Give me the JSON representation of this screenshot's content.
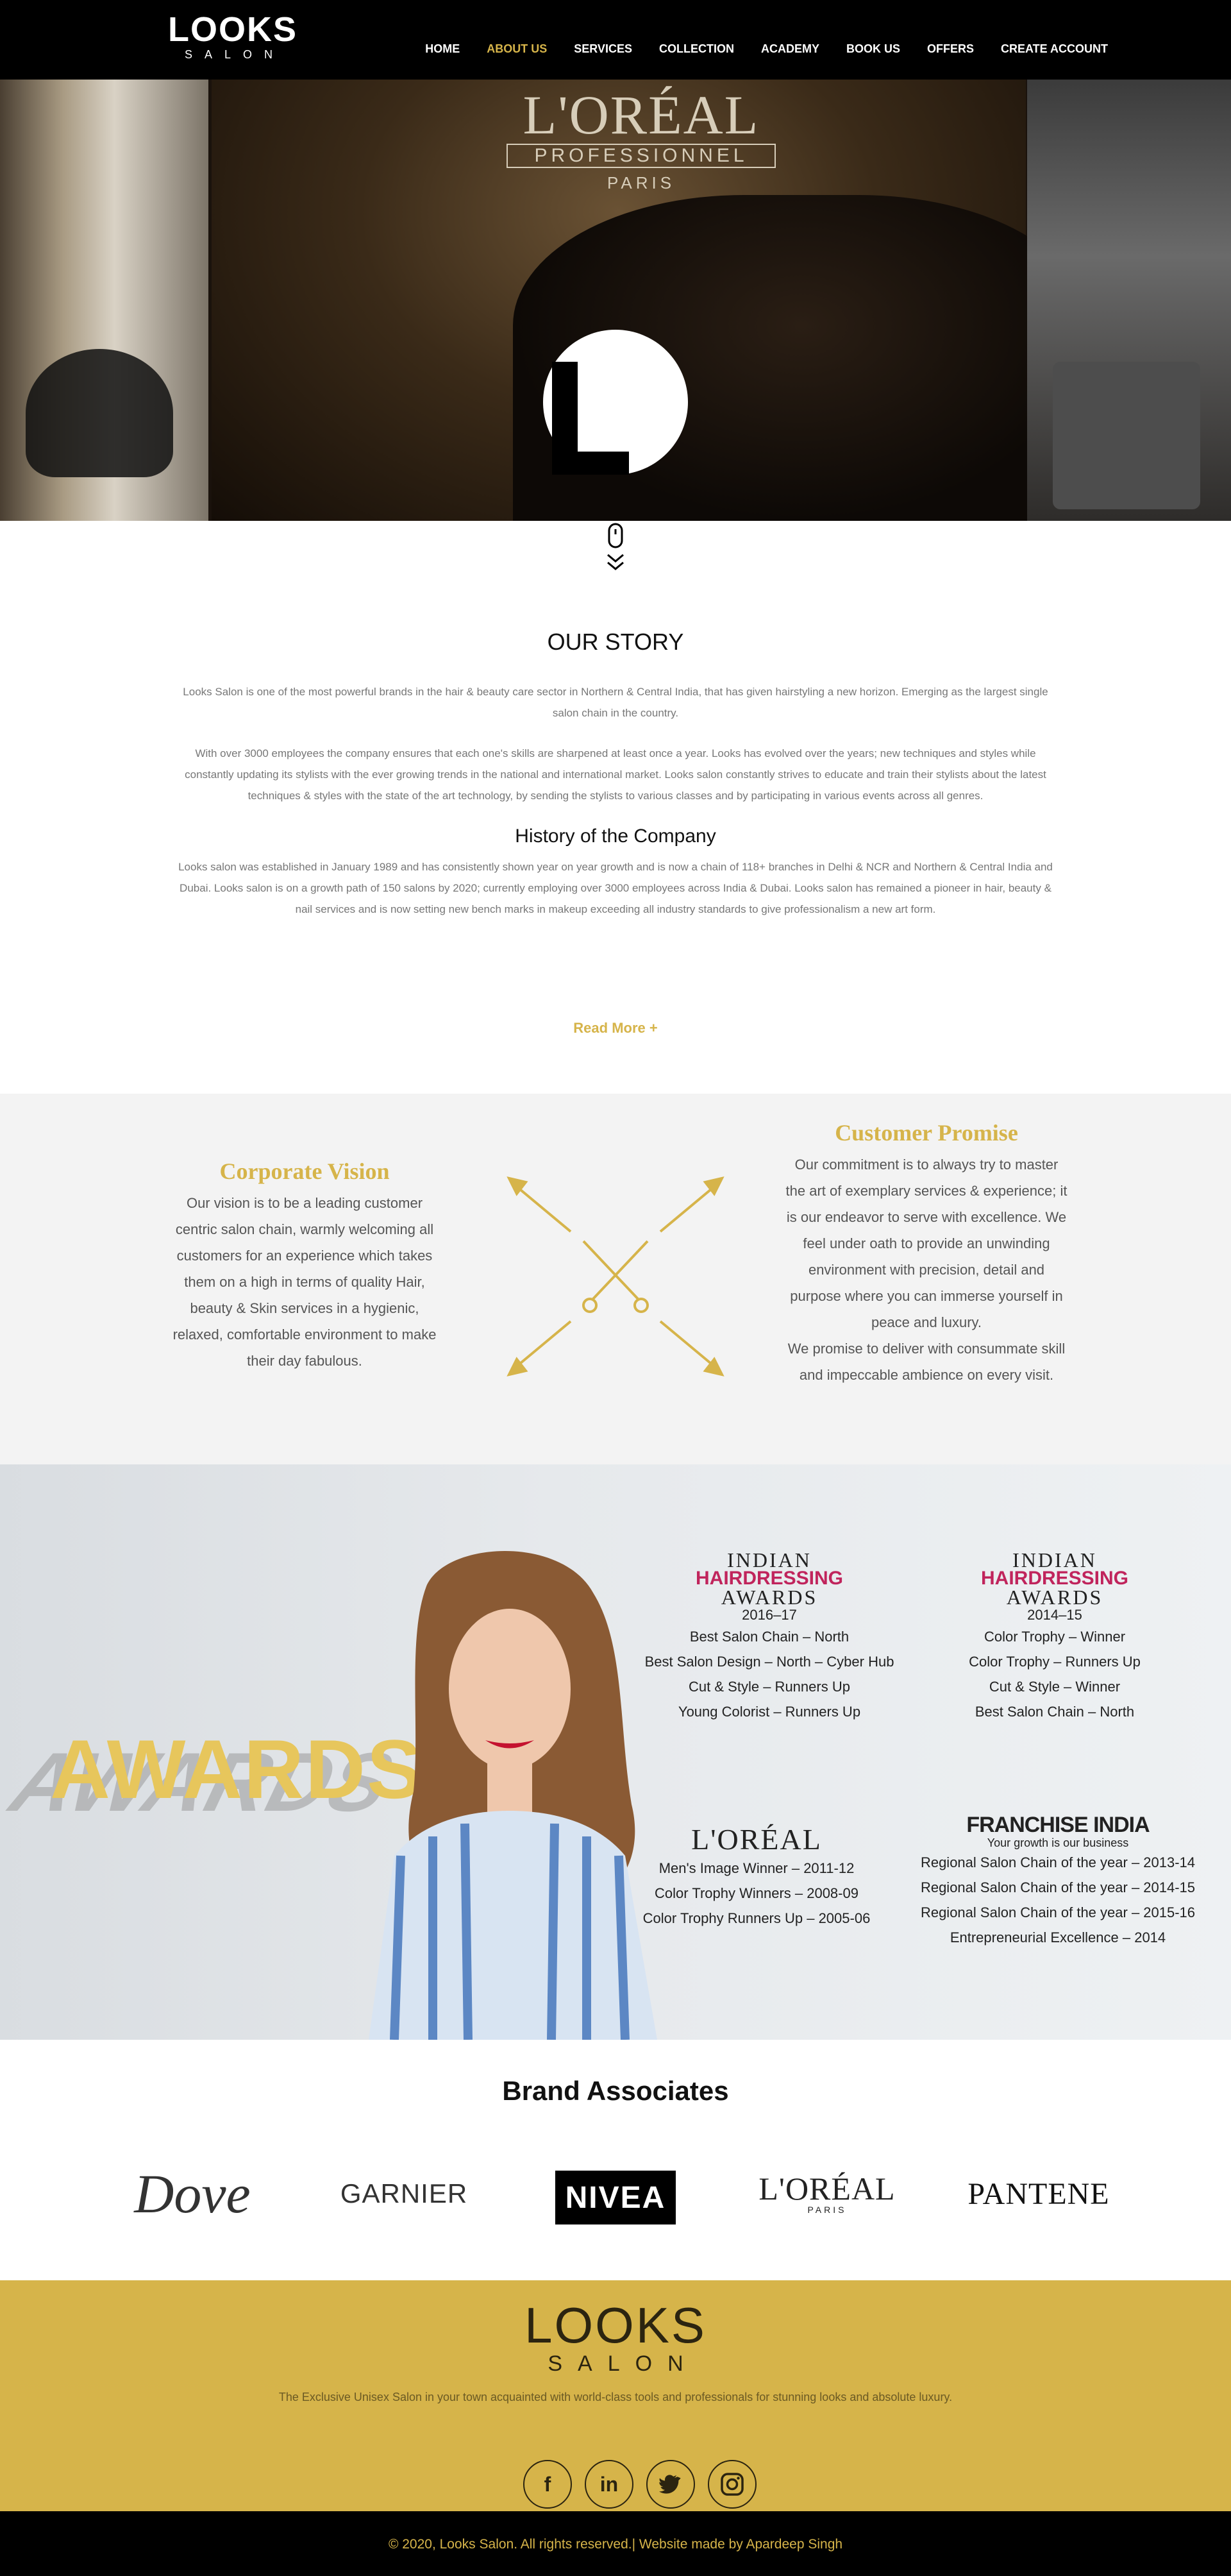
{
  "nav": {
    "logo_main": "LOOKS",
    "logo_sub": "SALON",
    "items": [
      {
        "label": "HOME"
      },
      {
        "label": "ABOUT US"
      },
      {
        "label": "SERVICES"
      },
      {
        "label": "COLLECTION"
      },
      {
        "label": "ACADEMY"
      },
      {
        "label": "BOOK US"
      },
      {
        "label": "OFFERS"
      },
      {
        "label": "CREATE ACCOUNT"
      }
    ],
    "active_item": "ABOUT US"
  },
  "hero": {
    "banner_line1": "L'ORÉAL",
    "banner_line2": "PROFESSIONNEL",
    "banner_line3": "PARIS",
    "badge_icon": "looks-L-logo"
  },
  "story": {
    "title": "OUR STORY",
    "para1": "Looks Salon is one of the most powerful brands in the hair & beauty care sector in Northern & Central India, that has given hairstyling a new horizon. Emerging as the largest single salon chain in the country.",
    "para2": "With over 3000 employees the company ensures that each one's skills are sharpened at least once a year. Looks has evolved over the years; new techniques and styles while constantly updating its stylists with the ever growing trends in the national and international market. Looks salon constantly strives to educate and train their stylists about the latest techniques & styles with the state of the art technology, by sending the stylists to various classes and by participating in various events across all genres.",
    "history_title": "History of the Company",
    "history_text": "Looks salon was established in January 1989 and has consistently shown year on year growth and is now a chain of 118+ branches in Delhi & NCR and Northern & Central India and Dubai. Looks salon is on a growth path of 150 salons by 2020; currently employing over 3000 employees across India & Dubai. Looks salon has remained a pioneer in hair, beauty & nail services and is now setting new bench marks in makeup exceeding all industry standards to give professionalism a new art form.",
    "read_more": "Read More +"
  },
  "vision": {
    "title": "Corporate Vision",
    "text": "Our vision is to be a leading customer centric salon chain, warmly welcoming all customers for an experience which takes them on a high in terms of quality Hair, beauty & Skin services in a hygienic, relaxed, comfortable environment to make their day fabulous."
  },
  "promise": {
    "title": "Customer Promise",
    "text1": "Our commitment is to always try to master the art of exemplary services & experience; it is our endeavor to serve with excellence. We feel under oath to provide an unwinding environment with precision, detail and purpose where you can immerse yourself in peace and luxury.",
    "text2": "We promise to deliver with consummate skill and impeccable ambience on every visit."
  },
  "awards": {
    "heading": "AWARDS",
    "ih1": {
      "logo_top": "INDIAN",
      "logo_mid": "HAIRDRESSING",
      "logo_bot": "AWARDS",
      "year": "2016–17",
      "items": [
        "Best Salon Chain – North",
        "Best Salon Design – North – Cyber Hub",
        "Cut & Style – Runners Up",
        "Young Colorist – Runners Up"
      ]
    },
    "ih2": {
      "logo_top": "INDIAN",
      "logo_mid": "HAIRDRESSING",
      "logo_bot": "AWARDS",
      "year": "2014–15",
      "items": [
        "Color Trophy – Winner",
        "Color Trophy – Runners Up",
        "Cut & Style – Winner",
        "Best Salon Chain – North"
      ]
    },
    "loreal": {
      "logo": "L'ORÉAL",
      "items": [
        "Men's Image Winner – 2011-12",
        "Color Trophy Winners – 2008-09",
        "Color Trophy Runners Up – 2005-06"
      ]
    },
    "franchise": {
      "logo": "FRANCHISE INDIA",
      "tagline": "Your growth is our business",
      "items": [
        "Regional Salon Chain of the year – 2013-14",
        "Regional Salon Chain of the year – 2014-15",
        "Regional Salon Chain of the year – 2015-16",
        "Entrepreneurial Excellence – 2014"
      ]
    }
  },
  "brands": {
    "title": "Brand Associates",
    "dove": "Dove",
    "garnier": "GARNIER",
    "nivea": "NIVEA",
    "loreal": "L'ORÉAL",
    "loreal_sub": "PARIS",
    "pantene": "PANTENE"
  },
  "footer": {
    "logo_main": "LOOKS",
    "logo_sub": "SALON",
    "tagline": "The Exclusive Unisex Salon in your town acquainted with world-class tools and professionals for stunning looks and absolute luxury.",
    "social": [
      {
        "icon": "facebook-icon",
        "glyph": "f"
      },
      {
        "icon": "linkedin-icon",
        "glyph": "in"
      },
      {
        "icon": "twitter-icon",
        "glyph": "t"
      },
      {
        "icon": "instagram-icon",
        "glyph": "◎"
      }
    ],
    "copyright": "© 2020, Looks Salon. All rights reserved.| Website made by Apardeep Singh"
  },
  "colors": {
    "accent": "#d6b44a",
    "nav_bg": "#000000",
    "section_bg": "#f3f3f3",
    "footer_bg": "#d6b44a"
  }
}
